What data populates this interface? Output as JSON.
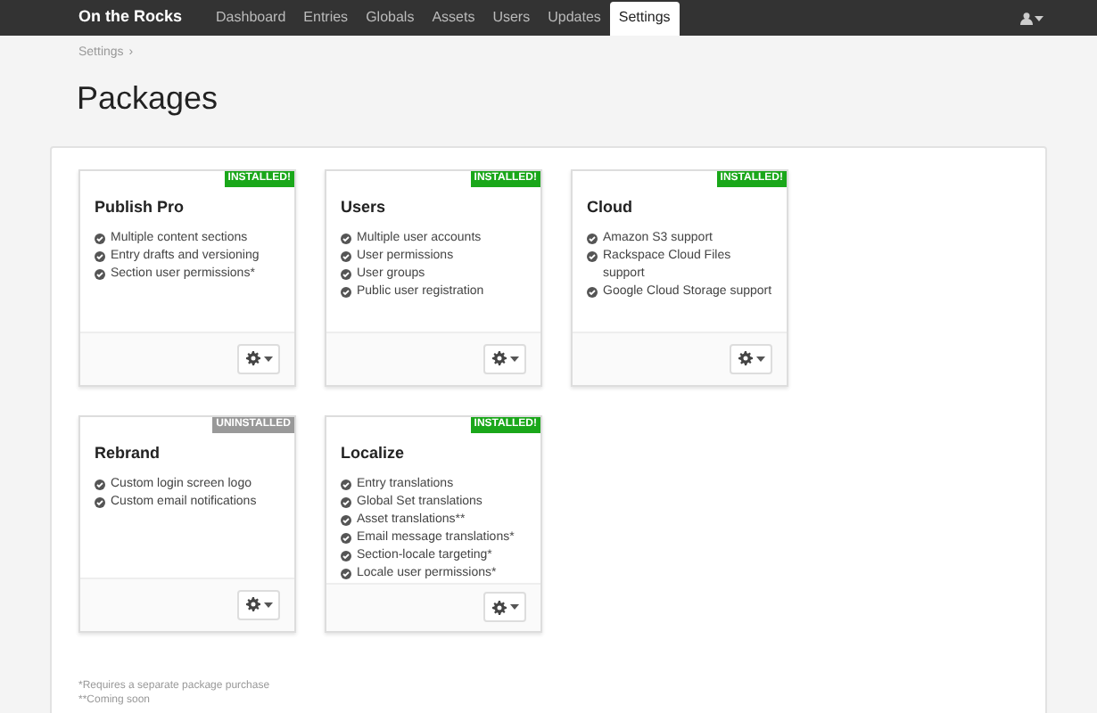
{
  "nav": {
    "brand": "On the Rocks",
    "tabs": [
      {
        "label": "Dashboard",
        "selected": false
      },
      {
        "label": "Entries",
        "selected": false
      },
      {
        "label": "Globals",
        "selected": false
      },
      {
        "label": "Assets",
        "selected": false
      },
      {
        "label": "Users",
        "selected": false
      },
      {
        "label": "Updates",
        "selected": false
      },
      {
        "label": "Settings",
        "selected": true
      }
    ]
  },
  "breadcrumb": [
    {
      "label": "Settings",
      "separator": "›"
    }
  ],
  "title": "Packages",
  "packages": [
    {
      "name": "Publish Pro",
      "status": "INSTALLED!",
      "installed": true,
      "features": [
        "Multiple content sections",
        "Entry drafts and versioning",
        "Section user permissions*"
      ]
    },
    {
      "name": "Users",
      "status": "INSTALLED!",
      "installed": true,
      "features": [
        "Multiple user accounts",
        "User permissions",
        "User groups",
        "Public user registration"
      ]
    },
    {
      "name": "Cloud",
      "status": "INSTALLED!",
      "installed": true,
      "features": [
        "Amazon S3 support",
        "Rackspace Cloud Files support",
        "Google Cloud Storage support"
      ]
    },
    {
      "name": "Rebrand",
      "status": "UNINSTALLED",
      "installed": false,
      "features": [
        "Custom login screen logo",
        "Custom email notifications"
      ]
    },
    {
      "name": "Localize",
      "status": "INSTALLED!",
      "installed": true,
      "features": [
        "Entry translations",
        "Global Set translations",
        "Asset translations**",
        "Email message translations*",
        "Section-locale targeting*",
        "Locale user permissions*"
      ]
    }
  ],
  "footnotes": [
    "*Requires a separate package purchase",
    "**Coming soon"
  ]
}
